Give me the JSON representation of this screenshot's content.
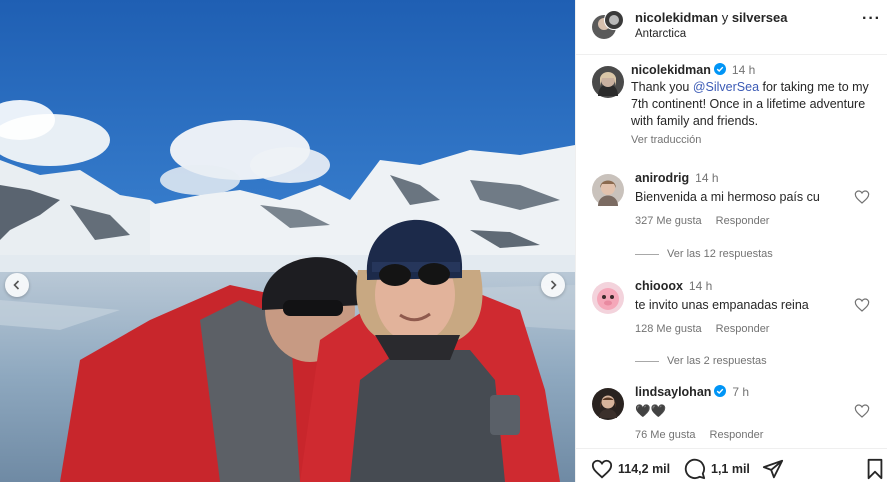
{
  "post": {
    "header": {
      "author": "nicolekidman",
      "separator": "y",
      "collaborator": "silversea",
      "location": "Antarctica",
      "more_label": "···"
    },
    "caption": {
      "username": "nicolekidman",
      "time": "14 h",
      "text_before": "Thank you ",
      "mention": "@SilverSea",
      "text_after": " for taking me to my 7th continent! Once in a lifetime adventure with family and friends.",
      "translate_label": "Ver traducción"
    },
    "comments": [
      {
        "username": "anirodrig",
        "time": "14 h",
        "text": "Bienvenida a mi hermoso país cu",
        "likes": "327 Me gusta",
        "reply_label": "Responder",
        "replies_label": "Ver las 12 respuestas"
      },
      {
        "username": "chiooox",
        "time": "14 h",
        "text": "te invito unas empanadas reina",
        "likes": "128 Me gusta",
        "reply_label": "Responder",
        "replies_label": "Ver las 2 respuestas"
      },
      {
        "username": "lindsaylohan",
        "time": "7 h",
        "text": "🖤🖤",
        "likes": "76 Me gusta",
        "reply_label": "Responder"
      }
    ],
    "actions": {
      "likes_count": "114,2 mil",
      "comments_count": "1,1 mil"
    }
  },
  "icons": {
    "verified": "verified-badge-icon",
    "heart": "heart-icon",
    "comment": "comment-bubble-icon",
    "share": "paper-plane-icon",
    "save": "bookmark-icon",
    "prev": "chevron-left-icon",
    "next": "chevron-right-icon"
  },
  "colors": {
    "verified": "#0095f6",
    "mention": "#3b5ab5",
    "secondary_text": "#737373",
    "primary_text": "#262626"
  }
}
